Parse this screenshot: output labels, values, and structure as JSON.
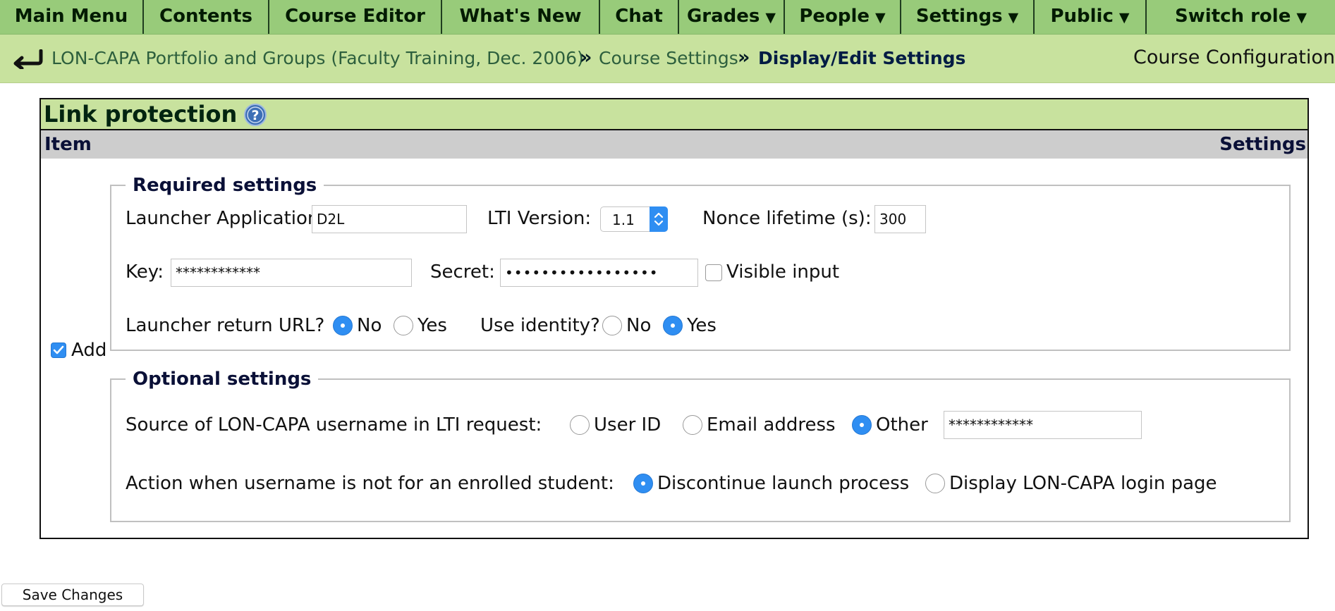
{
  "nav": {
    "items": [
      {
        "label": "Main Menu",
        "caret": false
      },
      {
        "label": "Contents",
        "caret": false
      },
      {
        "label": "Course Editor",
        "caret": false
      },
      {
        "label": "What's New",
        "caret": false
      },
      {
        "label": "Chat",
        "caret": false
      },
      {
        "label": "Grades",
        "caret": true
      },
      {
        "label": "People",
        "caret": true
      },
      {
        "label": "Settings",
        "caret": true
      },
      {
        "label": "Public",
        "caret": true
      },
      {
        "label": "Switch role",
        "caret": true
      }
    ],
    "caret_glyph": "▼"
  },
  "breadcrumb": {
    "course": "LON-CAPA Portfolio and Groups (Faculty Training, Dec. 2006)",
    "settings": "Course Settings",
    "current": "Display/Edit Settings",
    "separator": "»",
    "right_label": "Course Configuration"
  },
  "section": {
    "title": "Link protection",
    "col_item": "Item",
    "col_settings": "Settings"
  },
  "add": {
    "label": "Add",
    "checked": true
  },
  "required": {
    "legend": "Required settings",
    "launcher_label": "Launcher Application:",
    "launcher_value": "D2L",
    "lti_label": "LTI Version:",
    "lti_value": "1.1",
    "nonce_label": "Nonce lifetime (s):",
    "nonce_value": "300",
    "key_label": "Key:",
    "key_value": "************",
    "secret_label": "Secret:",
    "secret_value": "•••••••••••••••••",
    "visible_label": "Visible input",
    "return_label": "Launcher return URL?",
    "return_no": "No",
    "return_yes": "Yes",
    "return_selected": "No",
    "identity_label": "Use identity?",
    "identity_no": "No",
    "identity_yes": "Yes",
    "identity_selected": "Yes"
  },
  "optional": {
    "legend": "Optional settings",
    "source_label": "Source of LON-CAPA username in LTI request:",
    "source_userid": "User ID",
    "source_email": "Email address",
    "source_other": "Other",
    "source_selected": "Other",
    "other_value": "************",
    "action_label": "Action when username is not for an enrolled student:",
    "action_discontinue": "Discontinue launch process",
    "action_display": "Display LON-CAPA login page",
    "action_selected": "Discontinue launch process"
  },
  "save_label": "Save Changes",
  "colors": {
    "nav_bg": "#98cb7a",
    "crumb_bg": "#c8e29e",
    "accent_blue": "#2f8ef2"
  }
}
